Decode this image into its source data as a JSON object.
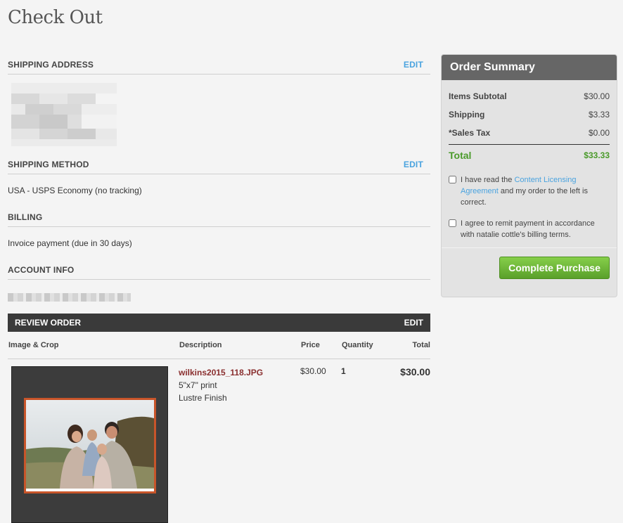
{
  "page": {
    "title": "Check Out"
  },
  "shipping_address": {
    "heading": "SHIPPING ADDRESS",
    "edit_label": "EDIT"
  },
  "shipping_method": {
    "heading": "SHIPPING METHOD",
    "edit_label": "EDIT",
    "value": "USA - USPS Economy (no tracking)"
  },
  "billing": {
    "heading": "BILLING",
    "value": "Invoice payment (due in 30 days)"
  },
  "account_info": {
    "heading": "ACCOUNT INFO"
  },
  "review_order": {
    "heading": "REVIEW ORDER",
    "edit_label": "EDIT",
    "columns": [
      "Image & Crop",
      "Description",
      "Price",
      "Quantity",
      "Total"
    ],
    "items": [
      {
        "filename": "wilkins2015_118.JPG",
        "size": "5\"x7\" print",
        "finish": "Lustre Finish",
        "price": "$30.00",
        "quantity": "1",
        "total": "$30.00"
      }
    ]
  },
  "order_summary": {
    "title": "Order Summary",
    "lines": [
      {
        "label": "Items Subtotal",
        "value": "$30.00"
      },
      {
        "label": "Shipping",
        "value": "$3.33"
      },
      {
        "label": "*Sales Tax",
        "value": "$0.00"
      }
    ],
    "total": {
      "label": "Total",
      "value": "$33.33"
    },
    "agreement1": {
      "prefix": "I have read the ",
      "link": "Content Licensing Agreement",
      "suffix": " and my order to the left is correct."
    },
    "agreement2": "I agree to remit payment in accordance with natalie cottle's billing terms.",
    "button_label": "Complete Purchase"
  },
  "colors": {
    "accent": "#4aa3df",
    "total_green": "#4a9a2a",
    "button_green": "#6ab83a",
    "crop_border": "#c8552a",
    "filename": "#8a2f2f"
  }
}
